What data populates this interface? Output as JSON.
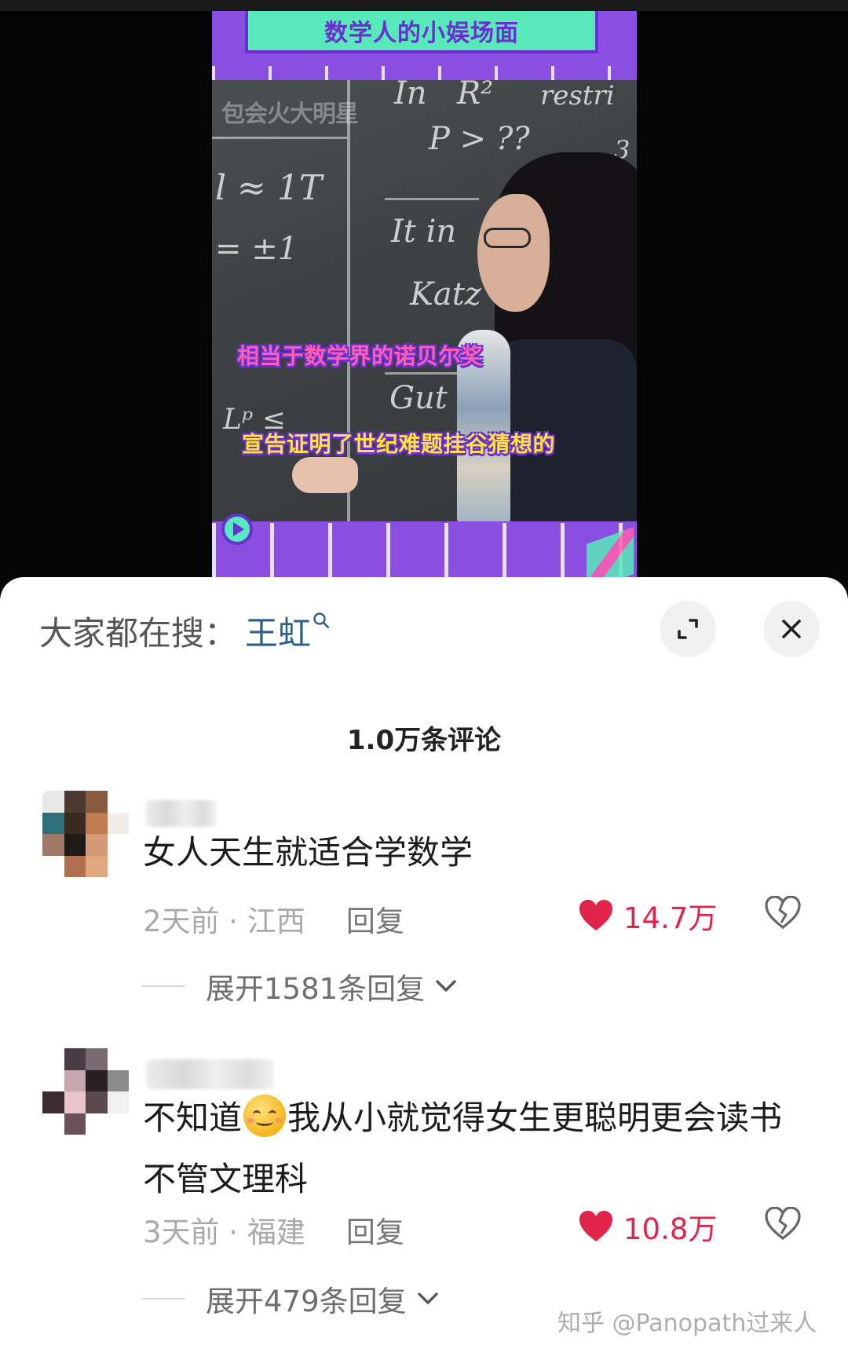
{
  "video": {
    "title_banner": "数学人的小娱场面",
    "channel_watermark": "包会火大明星",
    "subtitle_1": "相当于数学界的诺贝尔奖",
    "subtitle_2": "宣告证明了世纪难题挂谷猜想的",
    "chalk": {
      "in": "In",
      "r": "R²",
      "restr": "restri",
      "p": "P > ??",
      "approx": "l ≈ 1T",
      "pm": "= ±1",
      "it": "It in",
      "katz": "Katz",
      "gut": "Gut",
      "three": "3",
      "lp": "Lᵖ ≤"
    }
  },
  "search_bar": {
    "prefix": "大家都在搜：",
    "term": "王虹"
  },
  "comments_header": {
    "count_text": "1.0万条评论"
  },
  "comments": [
    {
      "text": "女人天生就适合学数学",
      "time_location": "2天前 · 江西",
      "reply_label": "回复",
      "likes": "14.7万",
      "expand_label": "展开1581条回复"
    },
    {
      "text_before_emoji": "不知道",
      "text_after_emoji": "我从小就觉得女生更聪明更会读书 不管文理科",
      "emoji": "smile-emoji",
      "time_location": "3天前 · 福建",
      "reply_label": "回复",
      "likes": "10.8万",
      "expand_label": "展开479条回复"
    }
  ],
  "watermark": "知乎 @Panopath过来人",
  "colors": {
    "accent_purple": "#8a4fe0",
    "accent_mint": "#57e9b9",
    "like_red": "#e0244a",
    "search_term_blue": "#2d5f8a"
  }
}
